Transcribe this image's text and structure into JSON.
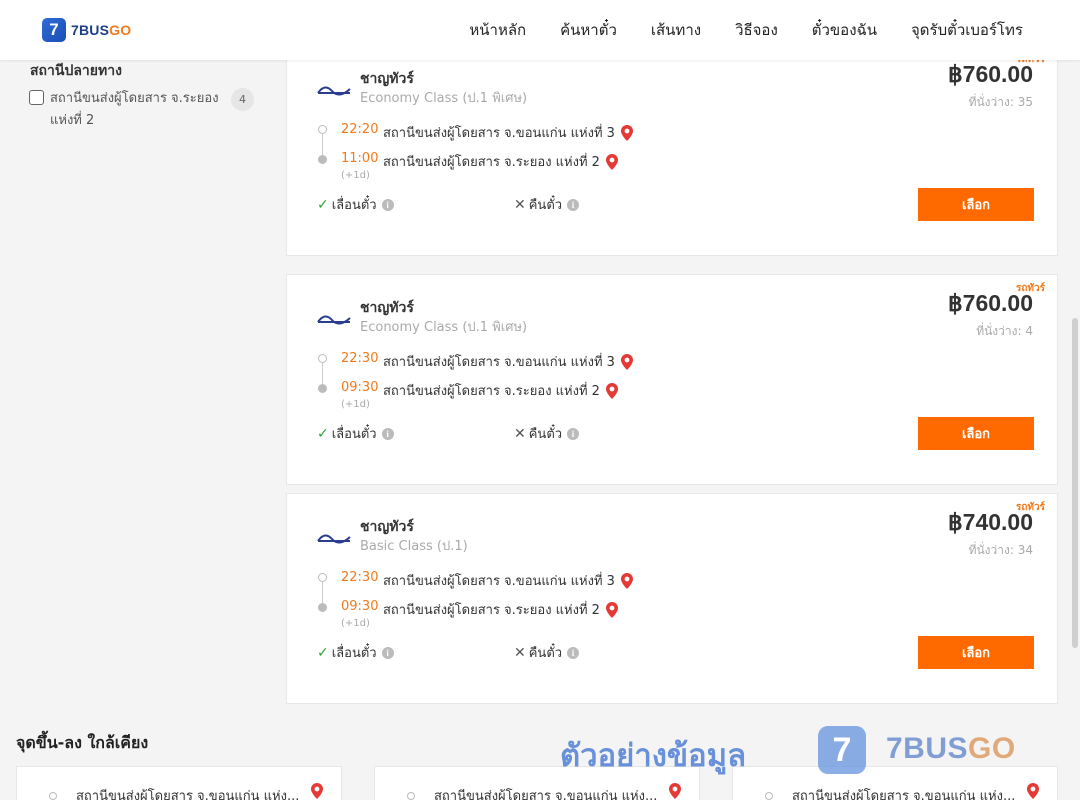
{
  "header": {
    "logo_mark": "7",
    "logo_text_a": "7BUS",
    "logo_text_b": "GO",
    "nav": [
      {
        "label": "หน้าหลัก"
      },
      {
        "label": "ค้นหาตั๋ว"
      },
      {
        "label": "เส้นทาง"
      },
      {
        "label": "วิธีจอง"
      },
      {
        "label": "ตั๋วของฉัน"
      },
      {
        "label": "จุดรับตั๋วเบอร์โทร"
      }
    ]
  },
  "sidebar": {
    "title": "สถานีปลายทาง",
    "filter": {
      "label": "สถานีขนส่งผู้โดยสาร จ.ระยอง แห่งที่ 2",
      "count": "4"
    }
  },
  "cards": [
    {
      "tag": "รถทัวร์",
      "operator": "ชาญทัวร์",
      "class": "Economy Class (ป.1 พิเศษ)",
      "price": "฿760.00",
      "seats": "ที่นั่งว่าง: 35",
      "dep_time": "22:20",
      "dep_station": "สถานีขนส่งผู้โดยสาร จ.ขอนแก่น แห่งที่ 3",
      "arr_time": "11:00",
      "arr_station": "สถานีขนส่งผู้โดยสาร จ.ระยอง แห่งที่ 2",
      "next_day": "(+1d)",
      "reschedule": "เลื่อนตั๋ว",
      "refund": "คืนตั๋ว",
      "button": "เลือก"
    },
    {
      "tag": "รถทัวร์",
      "operator": "ชาญทัวร์",
      "class": "Economy Class (ป.1 พิเศษ)",
      "price": "฿760.00",
      "seats": "ที่นั่งว่าง: 4",
      "dep_time": "22:30",
      "dep_station": "สถานีขนส่งผู้โดยสาร จ.ขอนแก่น แห่งที่ 3",
      "arr_time": "09:30",
      "arr_station": "สถานีขนส่งผู้โดยสาร จ.ระยอง แห่งที่ 2",
      "next_day": "(+1d)",
      "reschedule": "เลื่อนตั๋ว",
      "refund": "คืนตั๋ว",
      "button": "เลือก"
    },
    {
      "tag": "รถทัวร์",
      "operator": "ชาญทัวร์",
      "class": "Basic Class (ป.1)",
      "price": "฿740.00",
      "seats": "ที่นั่งว่าง: 34",
      "dep_time": "22:30",
      "dep_station": "สถานีขนส่งผู้โดยสาร จ.ขอนแก่น แห่งที่ 3",
      "arr_time": "09:30",
      "arr_station": "สถานีขนส่งผู้โดยสาร จ.ระยอง แห่งที่ 2",
      "next_day": "(+1d)",
      "reschedule": "เลื่อนตั๋ว",
      "refund": "คืนตั๋ว",
      "button": "เลือก"
    }
  ],
  "nearby": {
    "title": "จุดขึ้น-ลง ใกล้เคียง",
    "items": [
      {
        "label": "สถานีขนส่งผู้โดยสาร จ.ขอนแก่น แห่ง..."
      },
      {
        "label": "สถานีขนส่งผู้โดยสาร จ.ขอนแก่น แห่ง..."
      },
      {
        "label": "สถานีขนส่งผู้โดยสาร จ.ขอนแก่น แห่ง..."
      }
    ]
  },
  "watermark": {
    "text": "ตัวอย่างข้อมูล",
    "logo_mark": "7",
    "brand_a": "7BUS",
    "brand_b": "GO"
  },
  "colors": {
    "accent": "#ff6a00",
    "time": "#f07a1c",
    "pin": "#e53935",
    "check": "#2da33d"
  }
}
